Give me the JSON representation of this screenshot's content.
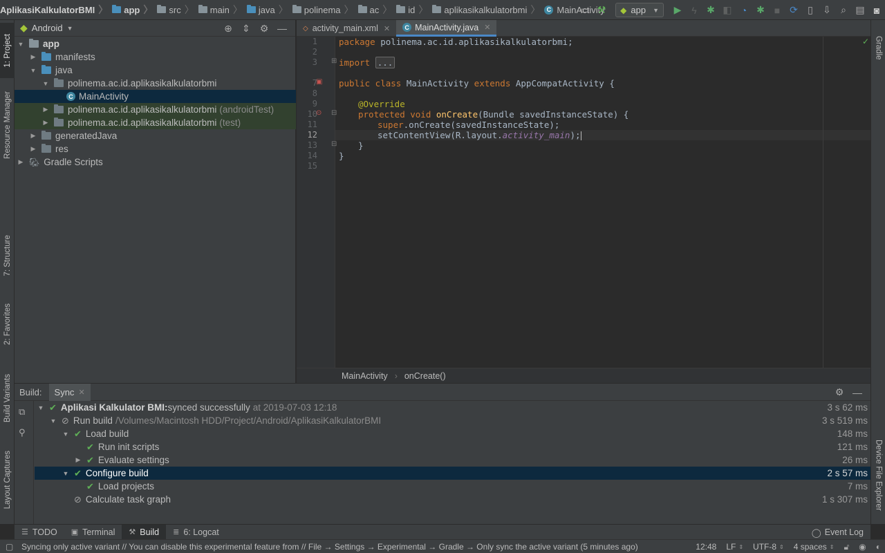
{
  "navbar": {
    "breadcrumbs": [
      {
        "label": "AplikasiKalkulatorBMI",
        "kind": "project"
      },
      {
        "label": "app",
        "kind": "module"
      },
      {
        "label": "src",
        "kind": "folder"
      },
      {
        "label": "main",
        "kind": "folder"
      },
      {
        "label": "java",
        "kind": "folder-blue"
      },
      {
        "label": "polinema",
        "kind": "folder"
      },
      {
        "label": "ac",
        "kind": "folder"
      },
      {
        "label": "id",
        "kind": "folder"
      },
      {
        "label": "aplikasikalkulatorbmi",
        "kind": "folder"
      },
      {
        "label": "MainActivity",
        "kind": "class"
      }
    ],
    "run_config": "app"
  },
  "left_tabs": {
    "project": "1: Project",
    "resource_manager": "Resource Manager",
    "structure": "7: Structure",
    "favorites": "2: Favorites",
    "build_variants": "Build Variants",
    "layout_captures": "Layout Captures"
  },
  "right_tabs": {
    "gradle": "Gradle",
    "device_file_explorer": "Device File Explorer"
  },
  "project_panel": {
    "view_mode": "Android",
    "tree": [
      {
        "label": "app",
        "suffix": "",
        "depth": 0,
        "expanded": true,
        "icon": "module",
        "bold": true
      },
      {
        "label": "manifests",
        "suffix": "",
        "depth": 1,
        "expanded": false,
        "icon": "folder-blue"
      },
      {
        "label": "java",
        "suffix": "",
        "depth": 1,
        "expanded": true,
        "icon": "folder-blue"
      },
      {
        "label": "polinema.ac.id.aplikasikalkulatorbmi",
        "suffix": "",
        "depth": 2,
        "expanded": true,
        "icon": "package"
      },
      {
        "label": "MainActivity",
        "suffix": "",
        "depth": 3,
        "expanded": null,
        "icon": "class",
        "selected": true
      },
      {
        "label": "polinema.ac.id.aplikasikalkulatorbmi",
        "suffix": "(androidTest)",
        "depth": 2,
        "expanded": false,
        "icon": "package",
        "test": true
      },
      {
        "label": "polinema.ac.id.aplikasikalkulatorbmi",
        "suffix": "(test)",
        "depth": 2,
        "expanded": false,
        "icon": "package",
        "test": true
      },
      {
        "label": "generatedJava",
        "suffix": "",
        "depth": 1,
        "expanded": false,
        "icon": "folder-gen"
      },
      {
        "label": "res",
        "suffix": "",
        "depth": 1,
        "expanded": false,
        "icon": "folder-res"
      },
      {
        "label": "Gradle Scripts",
        "suffix": "",
        "depth": 0,
        "expanded": false,
        "icon": "gradle"
      }
    ]
  },
  "editor": {
    "tabs": [
      {
        "label": "activity_main.xml",
        "active": false
      },
      {
        "label": "MainActivity.java",
        "active": true
      }
    ],
    "line_numbers": [
      "1",
      "2",
      "3",
      "7",
      "8",
      "9",
      "10",
      "11",
      "12",
      "13",
      "14",
      "15"
    ],
    "current_line": "12",
    "breadcrumb": [
      "MainActivity",
      "onCreate()"
    ],
    "code": {
      "l1_kw": "package",
      "l1_rest": " polinema.ac.id.aplikasikalkulatorbmi;",
      "l3_kw": "import",
      "l3_fold": "...",
      "l7_kw1": "public class",
      "l7_name": " MainActivity ",
      "l7_kw2": "extends",
      "l7_rest": " AppCompatActivity {",
      "l9_ann": "@Override",
      "l10_kw": "protected void",
      "l10_fn": " onCreate",
      "l10_rest": "(Bundle savedInstanceState) {",
      "l11_kw": "super",
      "l11_rest": ".onCreate(savedInstanceState);",
      "l12_pre": "setContentView(R.layout.",
      "l12_it": "activity_main",
      "l12_post": ");",
      "l13": "}",
      "l14": "}"
    }
  },
  "build": {
    "title": "Build:",
    "tab": "Sync",
    "rows": [
      {
        "label": "Aplikasi Kalkulator BMI:",
        "detail": " synced successfully",
        "path": "at 2019-07-03 12:18",
        "duration": "3 s 62 ms",
        "status": "ok",
        "depth": 0,
        "expanded": true,
        "bold": true
      },
      {
        "label": "Run build",
        "detail": "",
        "path": "/Volumes/Macintosh HDD/Project/Android/AplikasiKalkulatorBMI",
        "duration": "3 s 519 ms",
        "status": "skip",
        "depth": 1,
        "expanded": true
      },
      {
        "label": "Load build",
        "detail": "",
        "path": "",
        "duration": "148 ms",
        "status": "ok",
        "depth": 2,
        "expanded": true
      },
      {
        "label": "Run init scripts",
        "detail": "",
        "path": "",
        "duration": "121 ms",
        "status": "ok",
        "depth": 3,
        "expanded": null
      },
      {
        "label": "Evaluate settings",
        "detail": "",
        "path": "",
        "duration": "26 ms",
        "status": "ok",
        "depth": 3,
        "expanded": false
      },
      {
        "label": "Configure build",
        "detail": "",
        "path": "",
        "duration": "2 s 57 ms",
        "status": "ok",
        "depth": 2,
        "expanded": true,
        "selected": true
      },
      {
        "label": "Load projects",
        "detail": "",
        "path": "",
        "duration": "7 ms",
        "status": "ok",
        "depth": 3,
        "expanded": null
      },
      {
        "label": "Calculate task graph",
        "detail": "",
        "path": "",
        "duration": "1 s 307 ms",
        "status": "skip",
        "depth": 2,
        "expanded": null
      }
    ]
  },
  "tool_tabs": [
    {
      "label": "TODO",
      "icon": "list-icon",
      "active": false
    },
    {
      "label": "Terminal",
      "icon": "terminal-icon",
      "active": false
    },
    {
      "label": "Build",
      "icon": "hammer-icon",
      "active": true
    },
    {
      "label": "6: Logcat",
      "icon": "logcat-icon",
      "active": false
    }
  ],
  "event_log": "Event Log",
  "status_bar": {
    "message": "Syncing only active variant // You can disable this experimental feature from // File → Settings → Experimental → Gradle → Only sync the active variant (5 minutes ago)",
    "position": "12:48",
    "line_sep": "LF",
    "encoding": "UTF-8",
    "indent": "4 spaces"
  }
}
